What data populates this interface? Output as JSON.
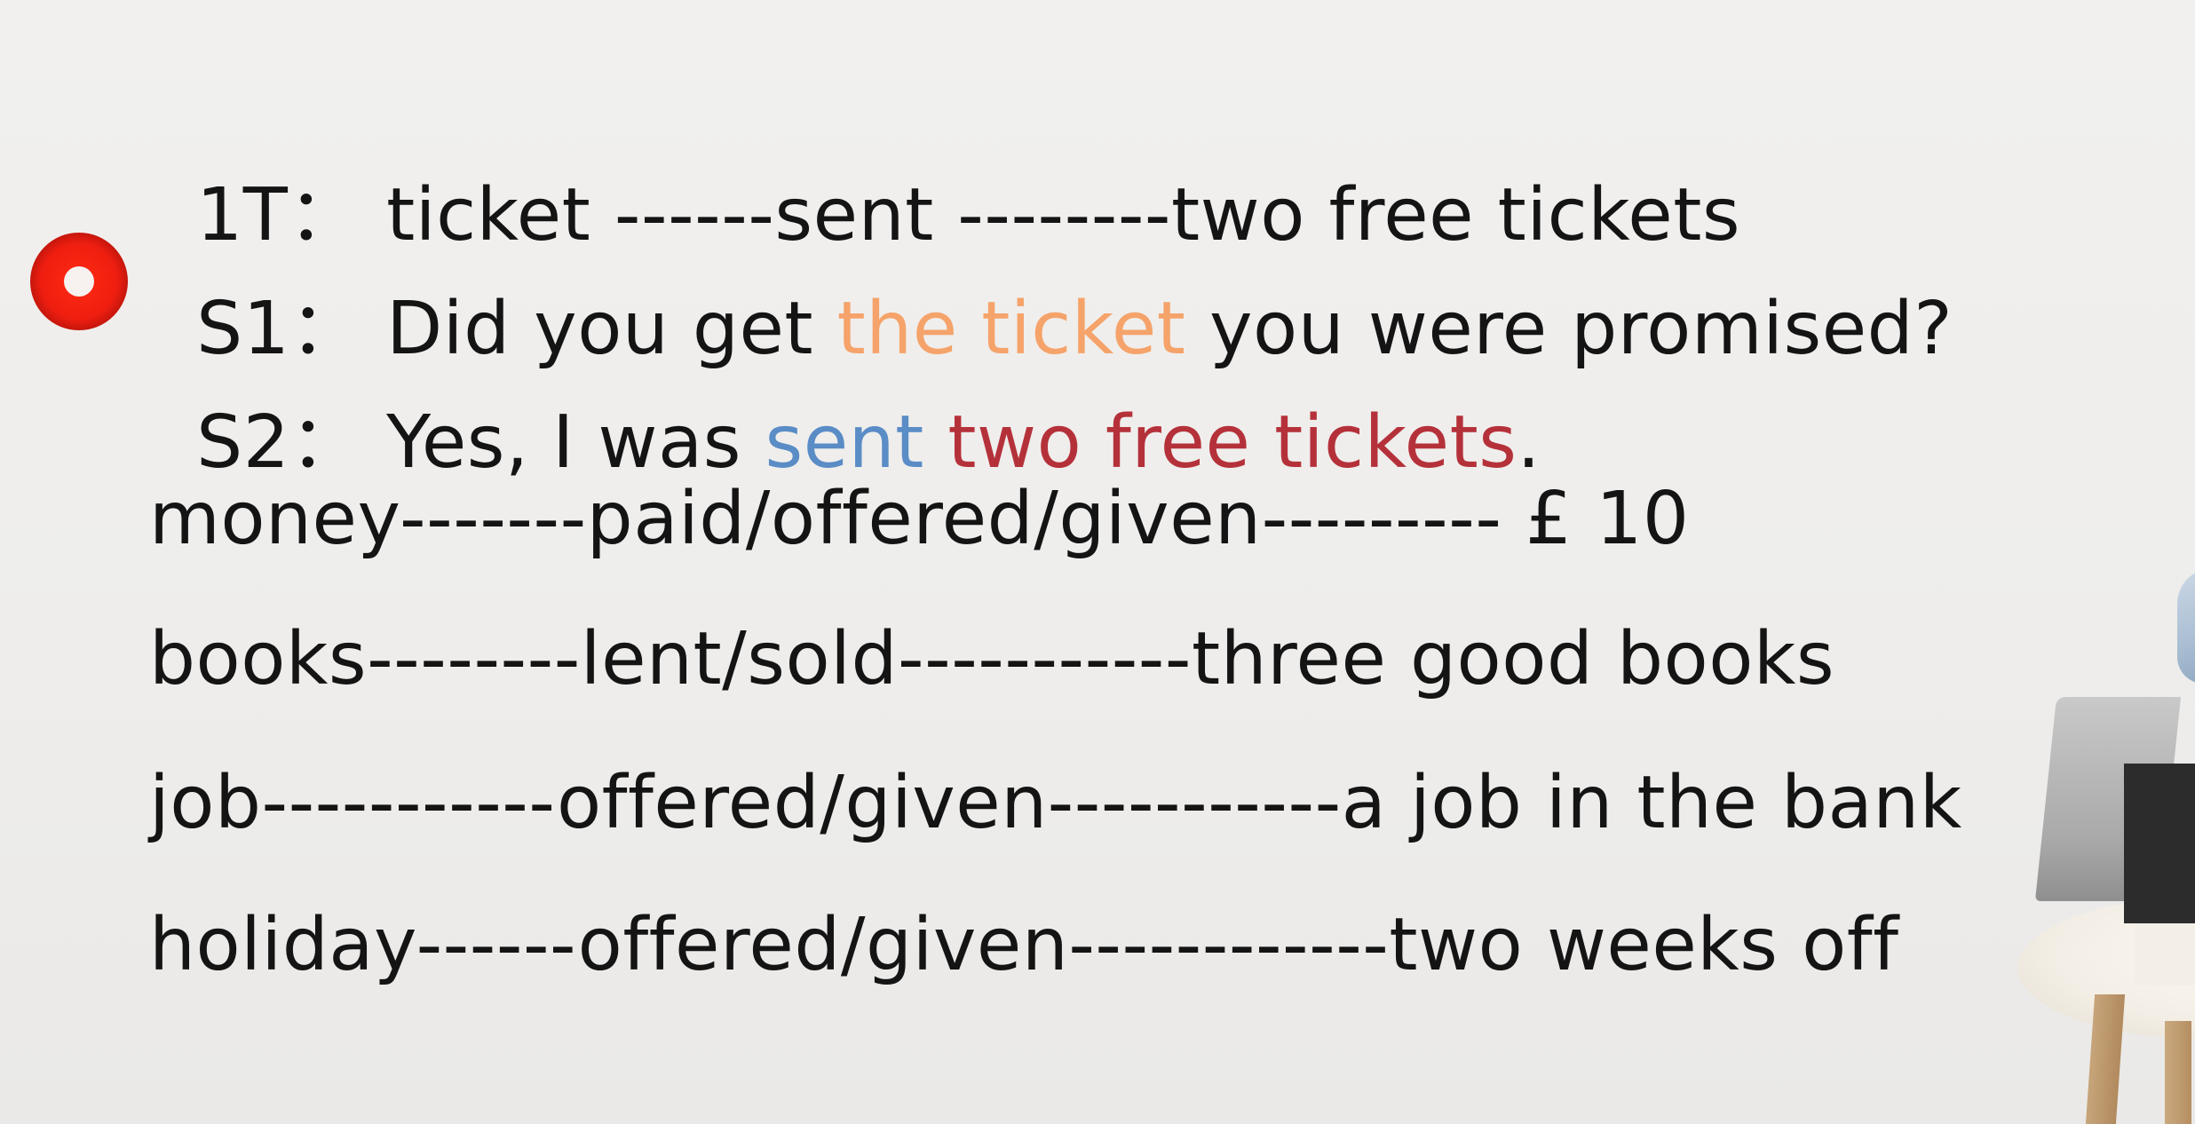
{
  "record_indicator": {
    "icon": "record-dot-icon",
    "color": "#ee1e10"
  },
  "dialogue": {
    "line1": {
      "label": "1T：",
      "text": "ticket ------sent --------two free tickets"
    },
    "line2": {
      "label": "S1：",
      "before": "Did you get ",
      "highlight": "the ticket",
      "after": " you were promised?",
      "highlight_color": "#f5a36a"
    },
    "line3": {
      "label": "S2：",
      "before": "Yes, I was ",
      "highlight_verb": "sent",
      "highlight_object": "two free tickets",
      "after": ".",
      "verb_color": "#5a8cc6",
      "object_color": "#b5313a"
    }
  },
  "patterns": [
    {
      "text": "money-------paid/offered/given--------- £ 10"
    },
    {
      "text": "books--------lent/sold-----------three good books"
    },
    {
      "text": "job-----------offered/given-----------a job in the bank"
    },
    {
      "text": "holiday------offered/given------------two weeks off"
    }
  ]
}
